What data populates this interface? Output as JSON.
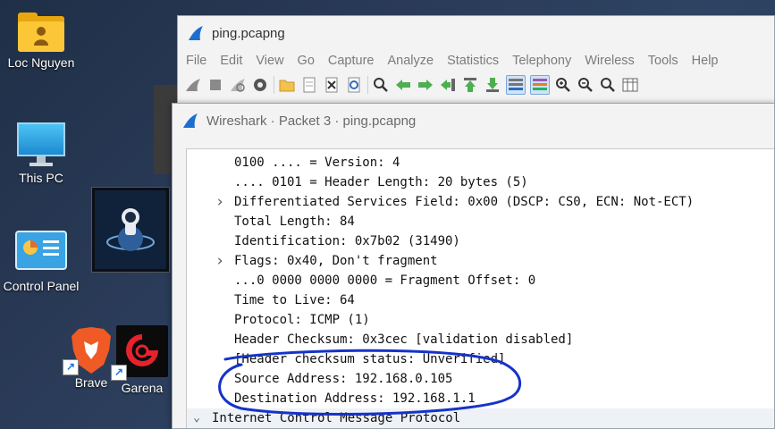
{
  "desktop": {
    "icons": [
      {
        "label": "Loc Nguyen"
      },
      {
        "label": "This PC"
      },
      {
        "label": "Control Panel"
      },
      {
        "label": "Brave"
      },
      {
        "label": "Garena"
      }
    ]
  },
  "main_window": {
    "title": "ping.pcapng",
    "menu": [
      "File",
      "Edit",
      "View",
      "Go",
      "Capture",
      "Analyze",
      "Statistics",
      "Telephony",
      "Wireless",
      "Tools",
      "Help"
    ],
    "toolbar_icons": [
      "shark-start-icon",
      "stop-icon",
      "restart-icon",
      "options-gear-icon",
      "open-folder-icon",
      "file-set-icon",
      "close-file-icon",
      "reload-icon",
      "find-icon",
      "back-arrow-icon",
      "forward-arrow-icon",
      "goto-packet-icon",
      "first-packet-icon",
      "last-packet-icon",
      "autoscroll-icon",
      "colorize-icon",
      "zoom-in-icon",
      "zoom-out-icon",
      "zoom-reset-icon",
      "resize-columns-icon"
    ]
  },
  "packet_dialog": {
    "title": "Wireshark · Packet 3 · ping.pcapng",
    "rows": [
      {
        "text": "0100 .... = Version: 4",
        "expander": ""
      },
      {
        "text": ".... 0101 = Header Length: 20 bytes (5)",
        "expander": ""
      },
      {
        "text": "Differentiated Services Field: 0x00 (DSCP: CS0, ECN: Not-ECT)",
        "expander": ">"
      },
      {
        "text": "Total Length: 84",
        "expander": ""
      },
      {
        "text": "Identification: 0x7b02 (31490)",
        "expander": ""
      },
      {
        "text": "Flags: 0x40, Don't fragment",
        "expander": ">"
      },
      {
        "text": "...0 0000 0000 0000 = Fragment Offset: 0",
        "expander": ""
      },
      {
        "text": "Time to Live: 64",
        "expander": ""
      },
      {
        "text": "Protocol: ICMP (1)",
        "expander": ""
      },
      {
        "text": "Header Checksum: 0x3cec [validation disabled]",
        "expander": ""
      },
      {
        "text": "[Header checksum status: Unverified]",
        "expander": ""
      },
      {
        "text": "Source Address: 192.168.0.105",
        "expander": ""
      },
      {
        "text": "Destination Address: 192.168.1.1",
        "expander": ""
      },
      {
        "text": "Internet Control Message Protocol",
        "expander": "v"
      }
    ]
  },
  "colors": {
    "annotation_ink": "#1533c9",
    "shark_blue": "#1c6fd1"
  }
}
